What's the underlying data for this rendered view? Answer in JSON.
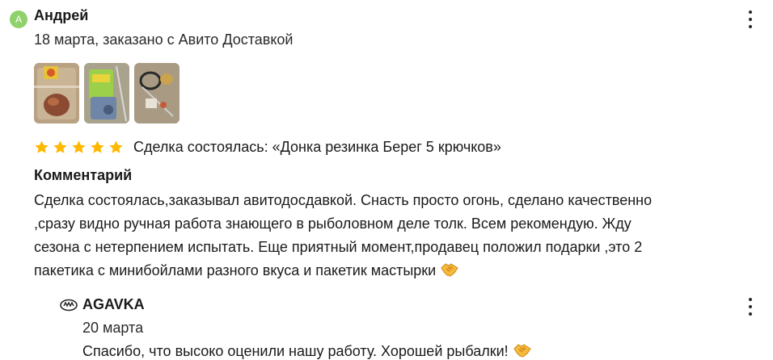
{
  "review": {
    "avatar_letter": "А",
    "author": "Андрей",
    "meta": "18 марта, заказано с Авито Доставкой",
    "rating": 5,
    "rating_max": 5,
    "deal_text": "Сделка состоялась: «Донка резинка Берег 5 крючков»",
    "comment_heading": "Комментарий",
    "comment_lines": [
      "Сделка состоялась,заказывал авитодосдавкой. Снасть просто огонь, сделано качественно",
      ",сразу видно ручная работа знающего в рыболовном деле толк. Всем рекомендую. Жду",
      "сезона с нетерпением испытать. Еще приятный момент,продавец положил подарки ,это 2",
      "пакетика с минибойлами разного вкуса и пакетик мастырки"
    ],
    "comment_emoji": "handshake-emoji",
    "photos": [
      "photo-1",
      "photo-2",
      "photo-3"
    ]
  },
  "reply": {
    "logo_icon": "agavka-logo-icon",
    "author": "AGAVKA",
    "date": "20 марта",
    "text": "Спасибо, что высоко оценили нашу работу. Хорошей рыбалки!",
    "emoji": "handshake-emoji"
  },
  "colors": {
    "star": "#ffb800",
    "avatar": "#8fd16a",
    "text": "#1a1a1a"
  }
}
